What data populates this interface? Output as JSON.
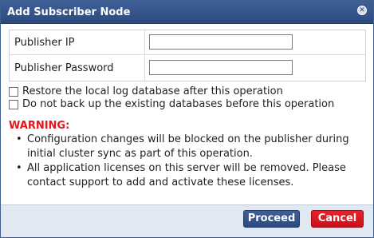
{
  "dialog": {
    "title": "Add Subscriber Node",
    "close_icon": "close-icon"
  },
  "form": {
    "publisher_ip_label": "Publisher IP",
    "publisher_ip_value": "",
    "publisher_password_label": "Publisher Password",
    "publisher_password_value": ""
  },
  "options": {
    "restore_log_label": "Restore the local log database after this operation",
    "restore_log_checked": false,
    "no_backup_label": "Do not back up the existing databases before this operation",
    "no_backup_checked": false
  },
  "warning": {
    "title": "WARNING:",
    "items": [
      "Configuration changes will be blocked on the publisher during initial cluster sync as part of this operation.",
      "All application licenses on this server will be removed. Please contact support to add and activate these licenses."
    ]
  },
  "footer": {
    "proceed_label": "Proceed",
    "cancel_label": "Cancel"
  },
  "colors": {
    "titlebar": "#2c4a7e",
    "warning": "#e8141c",
    "proceed": "#2a4a80",
    "cancel": "#c8101a"
  }
}
